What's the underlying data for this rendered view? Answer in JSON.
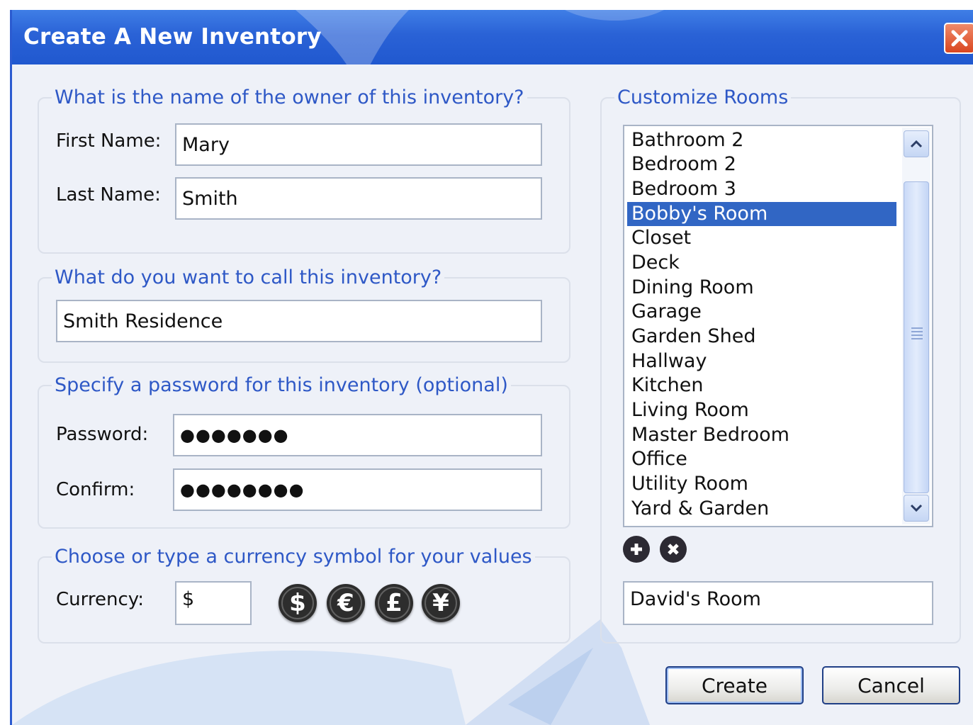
{
  "window": {
    "title": "Create A New Inventory"
  },
  "owner": {
    "legend": "What is the name of the owner of this inventory?",
    "first_name_label": "First Name:",
    "first_name_value": "Mary",
    "last_name_label": "Last Name:",
    "last_name_value": "Smith"
  },
  "inventory_name": {
    "legend": "What do you want to call this inventory?",
    "value": "Smith Residence"
  },
  "password": {
    "legend": "Specify a password for this inventory (optional)",
    "password_label": "Password:",
    "password_value": "●●●●●●●",
    "confirm_label": "Confirm:",
    "confirm_value": "●●●●●●●●"
  },
  "currency": {
    "legend": "Choose or type a currency symbol for your values",
    "label": "Currency:",
    "value": "$",
    "symbols": [
      "$",
      "€",
      "£",
      "¥"
    ]
  },
  "rooms": {
    "legend": "Customize Rooms",
    "items": [
      "Bathroom 2",
      "Bedroom 2",
      "Bedroom 3",
      "Bobby's Room",
      "Closet",
      "Deck",
      "Dining Room",
      "Garage",
      "Garden Shed",
      "Hallway",
      "Kitchen",
      "Living Room",
      "Master Bedroom",
      "Office",
      "Utility Room",
      "Yard & Garden"
    ],
    "selected_item": "Bobby's Room",
    "new_room_value": "David's Room"
  },
  "buttons": {
    "create": "Create",
    "cancel": "Cancel"
  },
  "colors": {
    "title_bar": "#2a62d6",
    "legend_text": "#2e58c6",
    "selection": "#3166c4",
    "close_button": "#d9461f"
  }
}
